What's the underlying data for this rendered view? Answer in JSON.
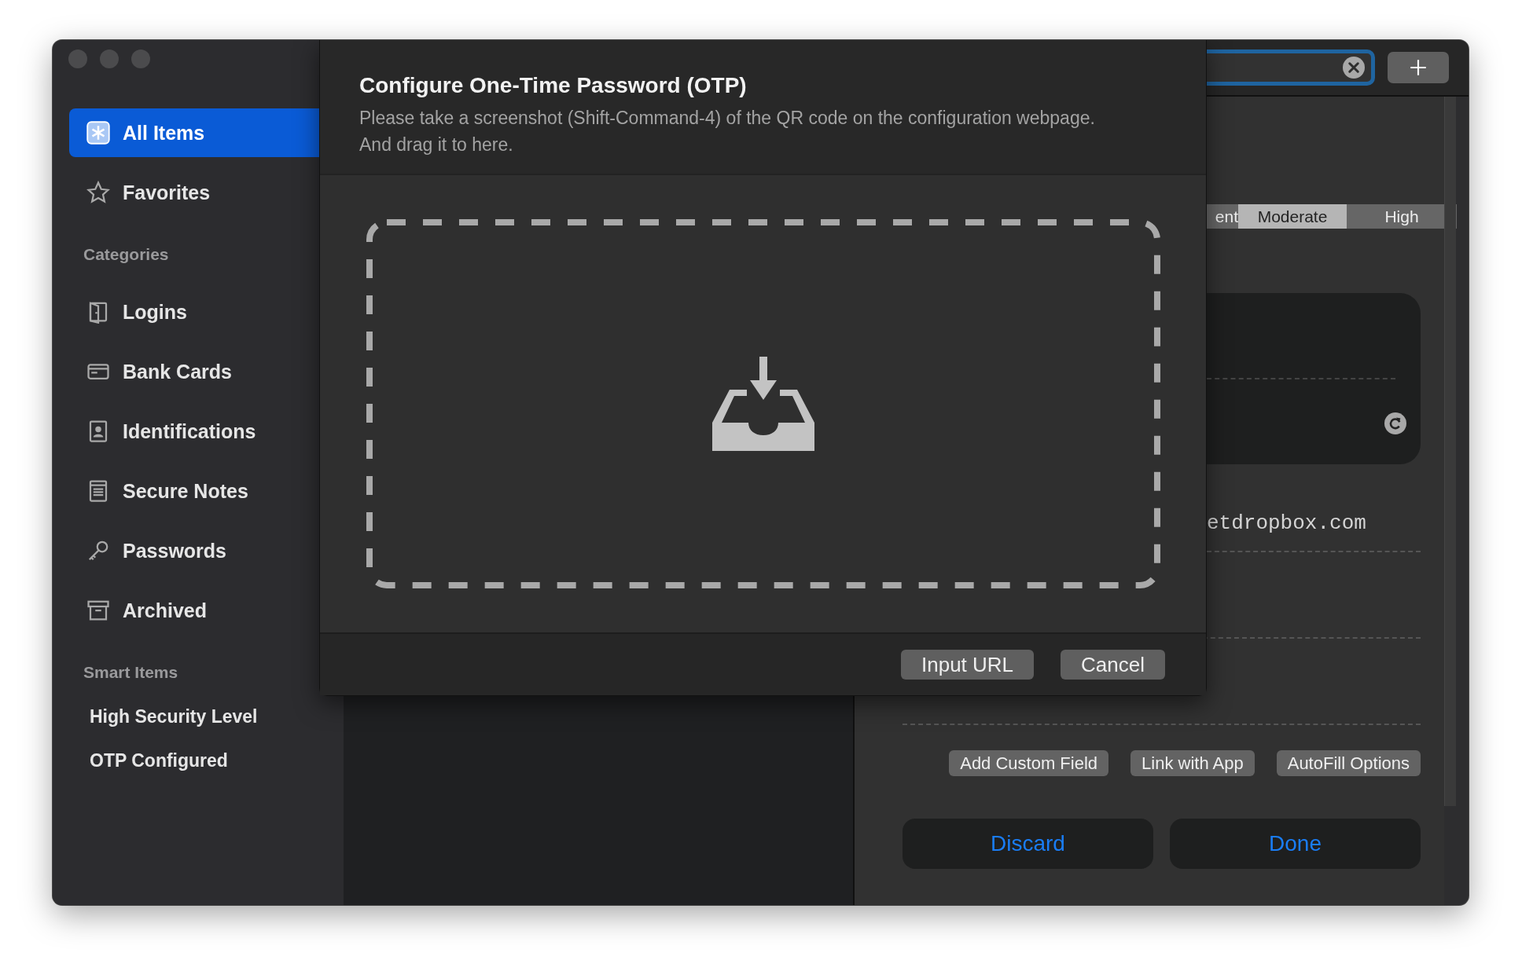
{
  "sidebar": {
    "items": [
      {
        "label": "All Items",
        "kind": "all",
        "selected": true
      },
      {
        "label": "Favorites",
        "kind": "favorites",
        "selected": false
      }
    ],
    "sections": [
      {
        "title": "Categories",
        "items": [
          {
            "label": "Logins",
            "kind": "logins",
            "selected": false
          },
          {
            "label": "Bank Cards",
            "kind": "cards",
            "selected": false
          },
          {
            "label": "Identifications",
            "kind": "identity",
            "selected": false
          },
          {
            "label": "Secure Notes",
            "kind": "notes",
            "selected": false
          },
          {
            "label": "Passwords",
            "kind": "passwords",
            "selected": false
          },
          {
            "label": "Archived",
            "kind": "archived",
            "selected": false
          }
        ]
      },
      {
        "title": "Smart Items",
        "items": [
          {
            "label": "High Security Level",
            "kind": "smart",
            "selected": false
          },
          {
            "label": "OTP Configured",
            "kind": "smart",
            "selected": false
          }
        ]
      }
    ]
  },
  "editor": {
    "strength_segments": [
      {
        "label": "ent",
        "selected": false
      },
      {
        "label": "Moderate",
        "selected": true
      },
      {
        "label": "High",
        "selected": false
      }
    ],
    "url_value": "etdropbox.com",
    "actions": [
      "Add Custom Field",
      "Link with App",
      "AutoFill Options"
    ],
    "footer_buttons": [
      "Discard",
      "Done"
    ]
  },
  "sheet": {
    "title": "Configure One-Time Password (OTP)",
    "message": "Please take a screenshot (Shift-Command-4) of the QR code on the configuration webpage. And drag it to here.",
    "buttons": [
      "Input URL",
      "Cancel"
    ]
  }
}
